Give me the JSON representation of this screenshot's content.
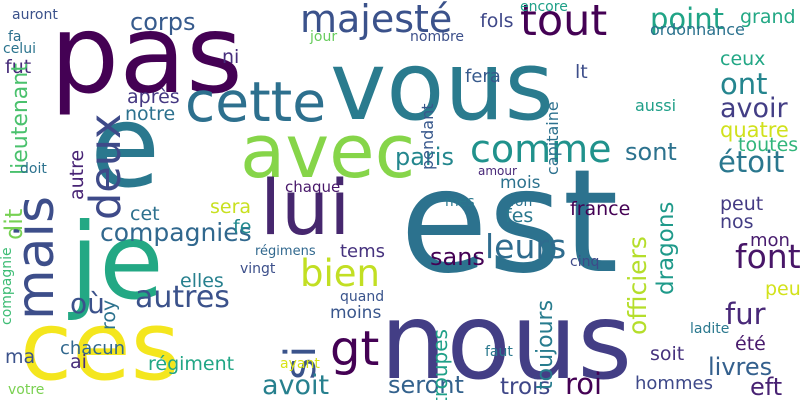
{
  "cloud": {
    "words": [
      {
        "text": "pas",
        "color": "#440154"
      },
      {
        "text": "vous",
        "color": "#2a7b8e"
      },
      {
        "text": "est",
        "color": "#2c728e"
      },
      {
        "text": "nous",
        "color": "#433e85"
      },
      {
        "text": "ces",
        "color": "#f4e61e"
      },
      {
        "text": "je",
        "color": "#23a884"
      },
      {
        "text": "e",
        "color": "#2a788e"
      },
      {
        "text": "avec",
        "color": "#86d549"
      },
      {
        "text": "mais",
        "color": "#3d4e8a"
      },
      {
        "text": "lui",
        "color": "#46276e"
      },
      {
        "text": "cette",
        "color": "#2d708e"
      },
      {
        "text": "comme",
        "color": "#20928c"
      },
      {
        "text": "tout",
        "color": "#440154"
      },
      {
        "text": "majesté",
        "color": "#3b528b"
      },
      {
        "text": "deux",
        "color": "#3e4a89"
      },
      {
        "text": "si",
        "color": "#3a538b"
      },
      {
        "text": "gt",
        "color": "#440154"
      },
      {
        "text": "bien",
        "color": "#c2df23"
      },
      {
        "text": "compagnies",
        "color": "#31688e"
      },
      {
        "text": "leurs",
        "color": "#2f6c8e"
      },
      {
        "text": "font",
        "color": "#481668"
      },
      {
        "text": "officiers",
        "color": "#b5de2b"
      },
      {
        "text": "autres",
        "color": "#3b528b"
      },
      {
        "text": "point",
        "color": "#20a486"
      },
      {
        "text": "ordonnance",
        "color": "#2c728e"
      },
      {
        "text": "ont",
        "color": "#25858e"
      },
      {
        "text": "ceux",
        "color": "#22a785"
      },
      {
        "text": "avoir",
        "color": "#433e85"
      },
      {
        "text": "quatre",
        "color": "#d0e11c"
      },
      {
        "text": "toutes",
        "color": "#31b57b"
      },
      {
        "text": "étoit",
        "color": "#2a778e"
      },
      {
        "text": "peut",
        "color": "#443a83"
      },
      {
        "text": "nos",
        "color": "#433d84"
      },
      {
        "text": "mon",
        "color": "#481c6e"
      },
      {
        "text": "fur",
        "color": "#482878"
      },
      {
        "text": "été",
        "color": "#481a6c"
      },
      {
        "text": "livres",
        "color": "#34608d"
      },
      {
        "text": "eft",
        "color": "#482273"
      },
      {
        "text": "hommes",
        "color": "#3e4989"
      },
      {
        "text": "roi",
        "color": "#440154"
      },
      {
        "text": "trois",
        "color": "#3f4788"
      },
      {
        "text": "seront",
        "color": "#33628d"
      },
      {
        "text": "avoit",
        "color": "#27808e"
      },
      {
        "text": "régiment",
        "color": "#21a685"
      },
      {
        "text": "chacun",
        "color": "#31688e"
      },
      {
        "text": "ai",
        "color": "#472d7b"
      },
      {
        "text": "où",
        "color": "#3b528b"
      },
      {
        "text": "sans",
        "color": "#440154"
      },
      {
        "text": "paris",
        "color": "#24878e"
      },
      {
        "text": "sont",
        "color": "#2c728e"
      },
      {
        "text": "dragons",
        "color": "#1f9a8a"
      },
      {
        "text": "france",
        "color": "#440154"
      },
      {
        "text": "sera",
        "color": "#c8e020"
      },
      {
        "text": "tems",
        "color": "#46327e"
      },
      {
        "text": "elles",
        "color": "#27808e"
      },
      {
        "text": "moins",
        "color": "#39568c"
      },
      {
        "text": "soit",
        "color": "#46327e"
      },
      {
        "text": "toujours",
        "color": "#287c8e"
      },
      {
        "text": "troupes",
        "color": "#1fa088"
      },
      {
        "text": "corps",
        "color": "#375b8d"
      },
      {
        "text": "fols",
        "color": "#3f4889"
      },
      {
        "text": "grand",
        "color": "#22a884"
      },
      {
        "text": "lt",
        "color": "#3d4e8a"
      },
      {
        "text": "aussi",
        "color": "#1f9f88"
      },
      {
        "text": "après",
        "color": "#453882"
      },
      {
        "text": "notre",
        "color": "#2c718e"
      },
      {
        "text": "autre",
        "color": "#482475"
      },
      {
        "text": "fut",
        "color": "#472c7a"
      },
      {
        "text": "ni",
        "color": "#472f7d"
      },
      {
        "text": "mois",
        "color": "#2c728e"
      },
      {
        "text": "chaque",
        "color": "#48186a"
      },
      {
        "text": "pendant",
        "color": "#38588c"
      },
      {
        "text": "capitaine",
        "color": "#2d718e"
      },
      {
        "text": "cet",
        "color": "#2d718e"
      },
      {
        "text": "fe",
        "color": "#23898e"
      },
      {
        "text": "fes",
        "color": "#2a788e"
      },
      {
        "text": "fon",
        "color": "#2c728e"
      },
      {
        "text": "amour",
        "color": "#482878"
      },
      {
        "text": "mes",
        "color": "#2a788e"
      },
      {
        "text": "fera",
        "color": "#375a8c"
      },
      {
        "text": "encore",
        "color": "#1fa088"
      },
      {
        "text": "nombre",
        "color": "#3c4f8a"
      },
      {
        "text": "jour",
        "color": "#67cc5c"
      },
      {
        "text": "auront",
        "color": "#3b528b"
      },
      {
        "text": "fa",
        "color": "#2d708e"
      },
      {
        "text": "celui",
        "color": "#2b748e"
      },
      {
        "text": "lieutenant",
        "color": "#4ac16d"
      },
      {
        "text": "doit",
        "color": "#2c728e"
      },
      {
        "text": "dit",
        "color": "#77d153"
      },
      {
        "text": "compagnie",
        "color": "#3dbc74"
      },
      {
        "text": "ma",
        "color": "#3b528b"
      },
      {
        "text": "votre",
        "color": "#7ad151"
      },
      {
        "text": "roy",
        "color": "#2c728e"
      },
      {
        "text": "régimens",
        "color": "#31688e"
      },
      {
        "text": "vingt",
        "color": "#3c4f8a"
      },
      {
        "text": "quand",
        "color": "#3a548c"
      },
      {
        "text": "ayant",
        "color": "#d8e219"
      },
      {
        "text": "faut",
        "color": "#2a788e"
      },
      {
        "text": "cinq",
        "color": "#3e4a89"
      },
      {
        "text": "ladite",
        "color": "#2a788e"
      },
      {
        "text": "peu",
        "color": "#d2e21b"
      }
    ]
  }
}
